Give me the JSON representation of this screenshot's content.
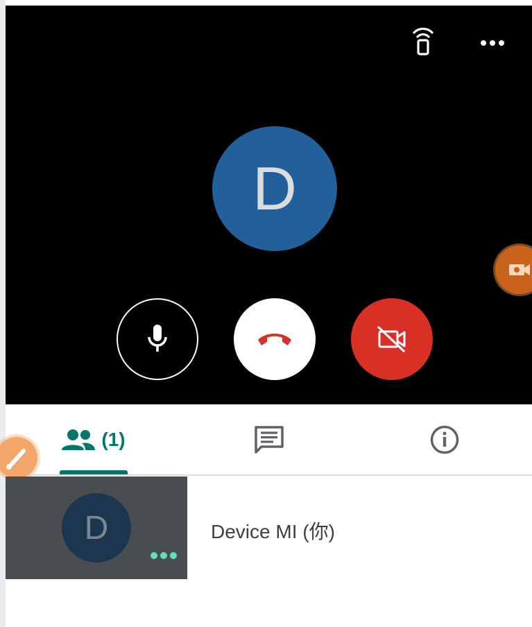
{
  "call": {
    "caller_initial": "D",
    "icons": {
      "cast": "cast-remote-icon",
      "more": "more-horizontal-icon",
      "mic": "microphone-icon",
      "hangup": "phone-hangup-icon",
      "camera": "video-off-icon"
    },
    "colors": {
      "avatar": "#22609b",
      "hangup": "#d93025",
      "camera_off": "#d93025"
    }
  },
  "tabs": [
    {
      "id": "people",
      "icon": "people-icon",
      "count": "(1)",
      "active": true
    },
    {
      "id": "chat",
      "icon": "chat-icon"
    },
    {
      "id": "info",
      "icon": "info-icon"
    }
  ],
  "participants": [
    {
      "initial": "D",
      "name": "Device MI (你)"
    }
  ],
  "accent_color": "#00796b"
}
